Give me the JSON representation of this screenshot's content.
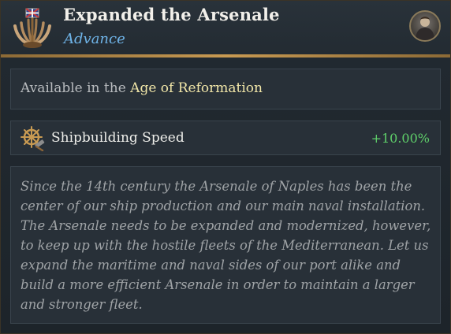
{
  "header": {
    "title": "Expanded the Arsenale",
    "subtitle": "Advance",
    "emblem_icon": "ship-hull-frame-icon",
    "avatar_icon": "ruler-portrait-avatar"
  },
  "availability": {
    "prefix": "Available in the",
    "age": "Age of Reformation"
  },
  "modifier": {
    "icon": "ship-wheel-hammer-icon",
    "label": "Shipbuilding Speed",
    "value": "+10.00%"
  },
  "description": {
    "lines": [
      "Since the 14th century the Arsenale of Naples has been the",
      "center of our ship production and our main naval installation.",
      "The Arsenale needs to be expanded and modernized, however,",
      "to keep up with the hostile fleets of the Mediterranean. Let us",
      "expand the maritime and naval sides of our port alike and",
      "build a more efficient Arsenale in order to maintain a larger",
      "and stronger fleet."
    ]
  },
  "colors": {
    "title": "#f2f0ea",
    "subtitle": "#6fb4e8",
    "age_highlight": "#f1e6a8",
    "positive_value": "#5fd06a",
    "divider_gold": "#c89a52"
  }
}
